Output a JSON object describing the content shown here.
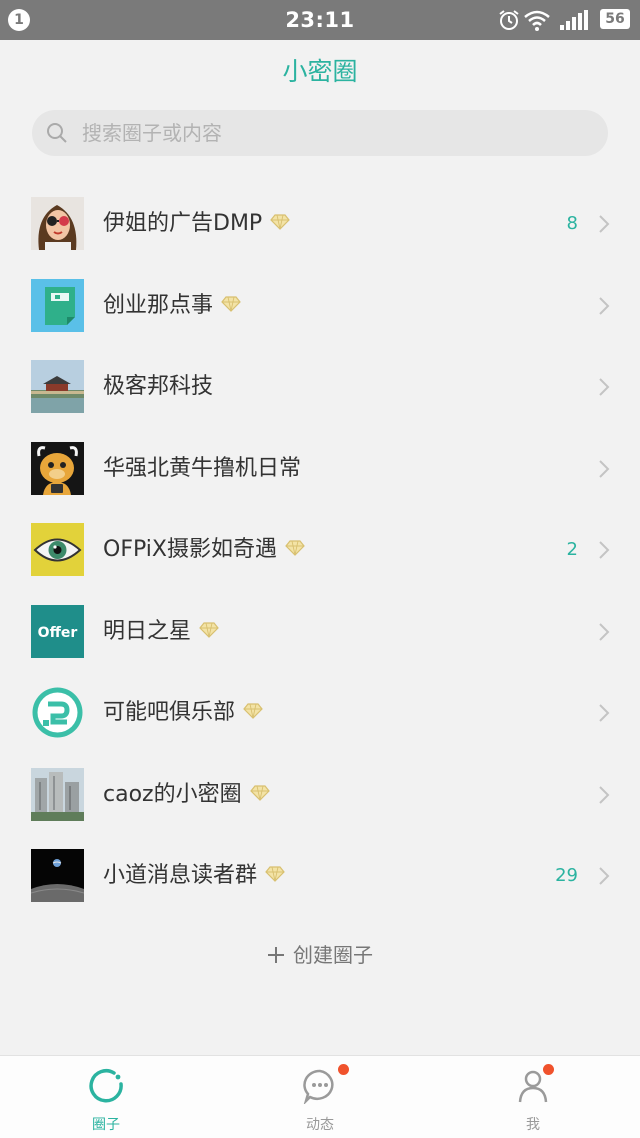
{
  "status_bar": {
    "notification_count": "1",
    "time": "23:11",
    "battery": "56"
  },
  "header": {
    "title": "小密圈"
  },
  "search": {
    "placeholder": "搜索圈子或内容"
  },
  "circles": [
    {
      "name": "伊姐的广告DMP",
      "diamond": true,
      "count": "8",
      "avatar": "cartoon-girl-avatar"
    },
    {
      "name": "创业那点事",
      "diamond": true,
      "count": "",
      "avatar": "green-folder-avatar"
    },
    {
      "name": "极客邦科技",
      "diamond": false,
      "count": "",
      "avatar": "palace-photo-avatar"
    },
    {
      "name": "华强北黄牛撸机日常",
      "diamond": false,
      "count": "",
      "avatar": "cartoon-bull-avatar"
    },
    {
      "name": "OFPiX摄影如奇遇",
      "diamond": true,
      "count": "2",
      "avatar": "eye-avatar"
    },
    {
      "name": "明日之星",
      "diamond": true,
      "count": "",
      "avatar": "offer-logo-avatar"
    },
    {
      "name": "可能吧俱乐部",
      "diamond": true,
      "count": "",
      "avatar": "kenengba-logo-avatar"
    },
    {
      "name": "caoz的小密圈",
      "diamond": true,
      "count": "",
      "avatar": "buildings-photo-avatar"
    },
    {
      "name": "小道消息读者群",
      "diamond": true,
      "count": "29",
      "avatar": "earthrise-photo-avatar"
    }
  ],
  "create_circle": {
    "label": "创建圈子"
  },
  "tab_bar": {
    "tabs": [
      {
        "label": "圈子",
        "icon": "circle-icon",
        "active": true,
        "badge": false
      },
      {
        "label": "动态",
        "icon": "chat-bubble-icon",
        "active": false,
        "badge": true
      },
      {
        "label": "我",
        "icon": "person-icon",
        "active": false,
        "badge": true
      }
    ]
  },
  "colors": {
    "accent": "#2bb3a0",
    "badge": "#f0522c",
    "diamond": "#e8d28a"
  }
}
